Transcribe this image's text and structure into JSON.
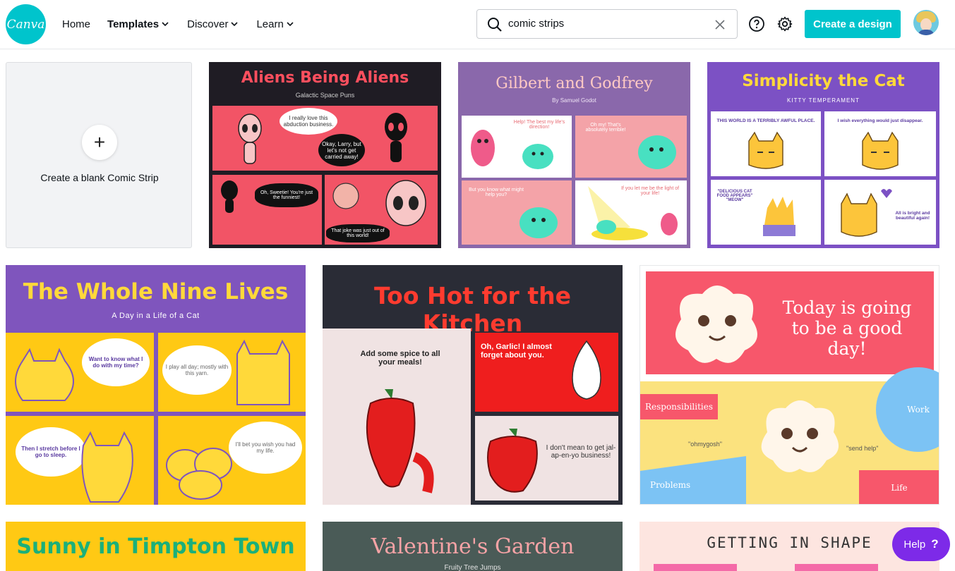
{
  "brand": {
    "logo_text": "Canva",
    "accent": "#00c4cc",
    "help_color": "#7d2ae8"
  },
  "nav": {
    "home": "Home",
    "templates": "Templates",
    "discover": "Discover",
    "learn": "Learn"
  },
  "search": {
    "value": "comic strips"
  },
  "header": {
    "create_label": "Create a design"
  },
  "blank": {
    "label": "Create a blank Comic Strip",
    "plus": "+"
  },
  "templates": [
    {
      "title": "Aliens Being Aliens",
      "subtitle": "Galactic Space Puns",
      "bubbles": [
        "I really love this abduction business.",
        "Okay, Larry, but let's not get carried away!",
        "Oh, Sweetie! You're just the funniest!",
        "That joke was just out of this world!"
      ]
    },
    {
      "title": "Gilbert and Godfrey",
      "subtitle": "By Samuel Godot",
      "bubbles": [
        "Help! The best my life's direction!",
        "Oh my! That's absolutely terrible!",
        "But you know what might help you?",
        "If you let me be the light of your life!"
      ]
    },
    {
      "title": "Simplicity the Cat",
      "subtitle": "KITTY TEMPERAMENT",
      "bubbles": [
        "THIS WORLD IS A TERRIBLY AWFUL PLACE.",
        "I wish everything would just disappear.",
        "\"DELICIOUS CAT FOOD APPEARS\" \"MEOW\"",
        "All is bright and beautiful again!"
      ]
    },
    {
      "title": "The Whole Nine Lives",
      "subtitle": "A Day in a Life of a Cat",
      "bubbles": [
        "Want to know what I do with my time?",
        "I play all day; mostly with this yarn.",
        "Then I stretch before I go to sleep.",
        "I'll bet you wish you had my life."
      ]
    },
    {
      "title": "Too Hot for the Kitchen",
      "bubbles": [
        "Add some spice to all your meals!",
        "Oh, Garlic! I almost forget about you.",
        "I don't mean to get jal-ap-en-yo business!"
      ]
    },
    {
      "title": "Today is going to be a good day!",
      "labels": [
        "Responsibilities",
        "Work",
        "\"ohmygosh\"",
        "\"send help\"",
        "Problems",
        "Life"
      ]
    },
    {
      "title": "Sunny in Timpton Town"
    },
    {
      "title": "Valentine's Garden",
      "subtitle": "Fruity Tree Jumps"
    },
    {
      "title": "GETTING IN SHAPE"
    }
  ],
  "help": {
    "label": "Help",
    "icon": "?"
  }
}
